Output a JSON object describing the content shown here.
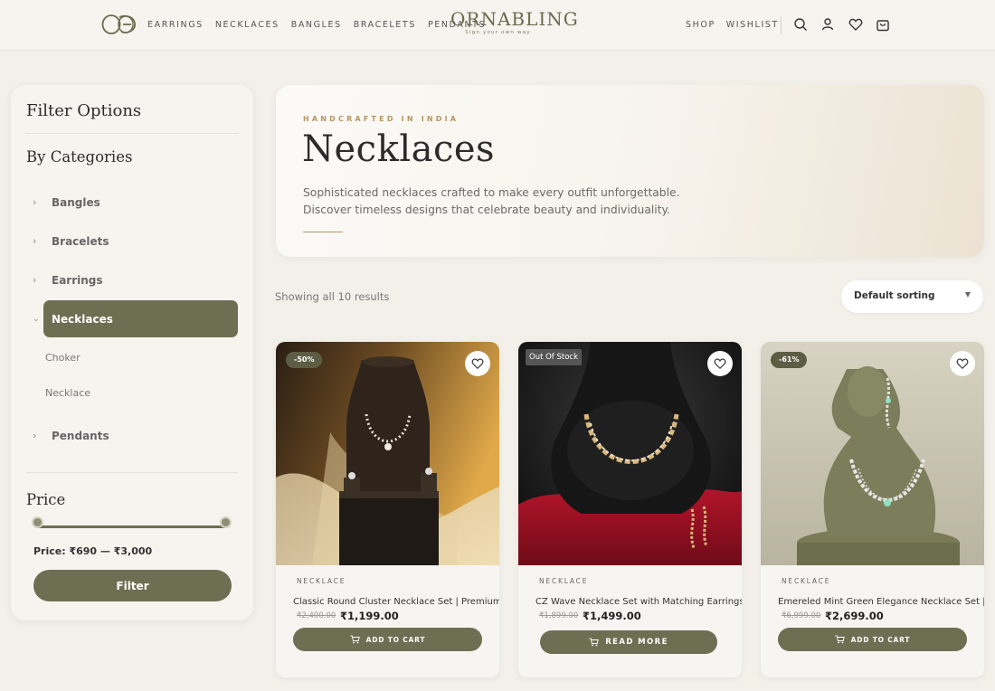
{
  "header": {
    "nav_left": [
      "EARRINGS",
      "NECKLACES",
      "BANGLES",
      "BRACELETS",
      "PENDANTS"
    ],
    "brand_name": "ORNABLING",
    "brand_tagline": "Sign your own way",
    "nav_right": [
      "SHOP",
      "WISHLIST"
    ],
    "icons": [
      "search-icon",
      "user-icon",
      "heart-icon",
      "bag-icon"
    ]
  },
  "sidebar": {
    "title": "Filter Options",
    "categories_title": "By Categories",
    "categories": [
      "Bangles",
      "Bracelets",
      "Earrings",
      "Necklaces",
      "Pendants"
    ],
    "active_category": "Necklaces",
    "subcategories": [
      "Choker",
      "Necklace"
    ],
    "price_title": "Price",
    "price_range": "Price: ₹690 — ₹3,000",
    "filter_label": "Filter"
  },
  "hero": {
    "kicker": "HANDCRAFTED IN INDIA",
    "title": "Necklaces",
    "description": "Sophisticated necklaces crafted to make every outfit unforgettable. Discover timeless designs that celebrate beauty and individuality."
  },
  "toolbar": {
    "result_count": "Showing all 10 results",
    "sort_label": "Default sorting"
  },
  "products": [
    {
      "badge": "-50%",
      "category": "NECKLACE",
      "title": "Classic Round Cluster Necklace Set | Premium",
      "old_price": "₹2,400.00",
      "price": "₹1,199.00",
      "button": "ADD TO CART"
    },
    {
      "badge": "Out Of Stock",
      "category": "NECKLACE",
      "title": "CZ Wave Necklace Set with Matching Earrings |",
      "old_price": "₹1,899.00",
      "price": "₹1,499.00",
      "button": "READ MORE"
    },
    {
      "badge": "-61%",
      "category": "NECKLACE",
      "title": "Emereled Mint Green Elegance Necklace Set | S",
      "old_price": "₹6,999.00",
      "price": "₹2,699.00",
      "button": "ADD TO CART"
    }
  ],
  "colors": {
    "accent": "#6d6f52",
    "background": "#f3f0ea",
    "gold": "#b5955f"
  }
}
